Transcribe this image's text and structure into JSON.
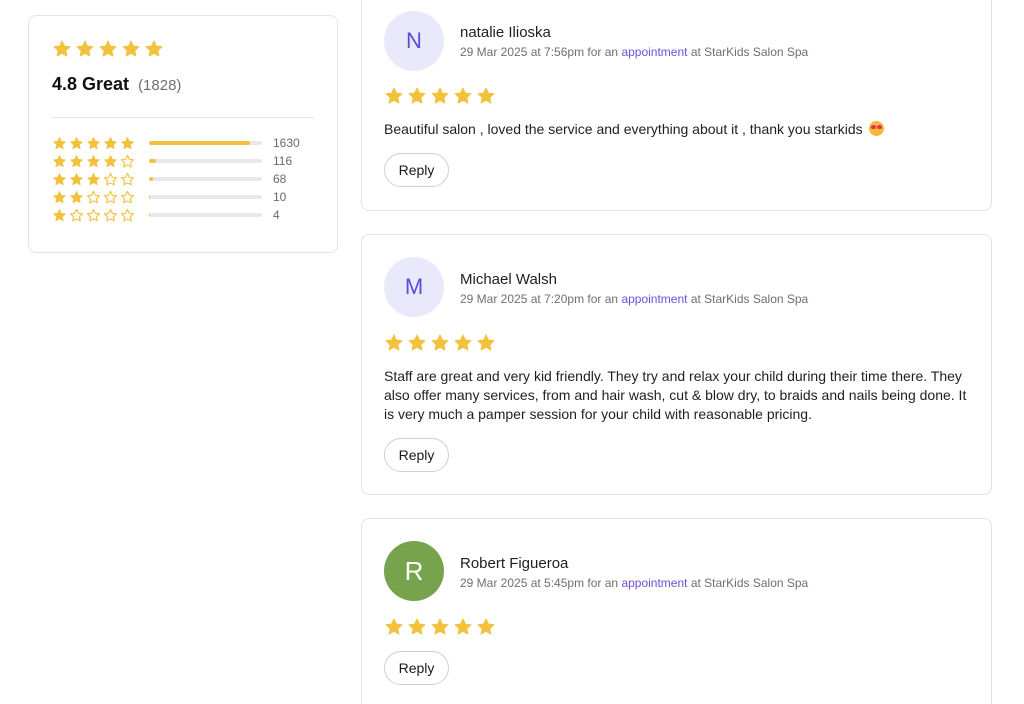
{
  "summary": {
    "rating": 5,
    "score_label": "4.8 Great",
    "count_label": "(1828)",
    "distribution": [
      {
        "stars": 5,
        "count": "1630",
        "fraction": 0.89
      },
      {
        "stars": 4,
        "count": "116",
        "fraction": 0.06
      },
      {
        "stars": 3,
        "count": "68",
        "fraction": 0.035
      },
      {
        "stars": 2,
        "count": "10",
        "fraction": 0.005
      },
      {
        "stars": 1,
        "count": "4",
        "fraction": 0.002
      }
    ]
  },
  "colors": {
    "star": "#f2c13d",
    "star_empty_stroke": "#f2c13d",
    "link": "#6b4fd8"
  },
  "reviews": [
    {
      "initial": "N",
      "name": "natalie Ilioska",
      "meta_prefix": "29 Mar 2025 at 7:56pm for an ",
      "meta_link": "appointment",
      "meta_suffix": " at StarKids Salon Spa",
      "rating": 5,
      "text": "Beautiful salon , loved the service and everything about it , thank you starkids",
      "emoji": "heart-eyes-emoji",
      "reply_label": "Reply"
    },
    {
      "initial": "M",
      "name": "Michael Walsh",
      "meta_prefix": "29 Mar 2025 at 7:20pm for an ",
      "meta_link": "appointment",
      "meta_suffix": " at StarKids Salon Spa",
      "rating": 5,
      "text": "Staff are great and very kid friendly. They try and relax your child during their time there. They also offer many services, from and hair wash, cut & blow dry, to braids and nails being done. It is very much a pamper session for your child with reasonable pricing.",
      "reply_label": "Reply"
    },
    {
      "initial": "R",
      "name": "Robert Figueroa",
      "meta_prefix": "29 Mar 2025 at 5:45pm for an ",
      "meta_link": "appointment",
      "meta_suffix": " at StarKids Salon Spa",
      "rating": 5,
      "text": "",
      "reply_label": "Reply"
    }
  ]
}
